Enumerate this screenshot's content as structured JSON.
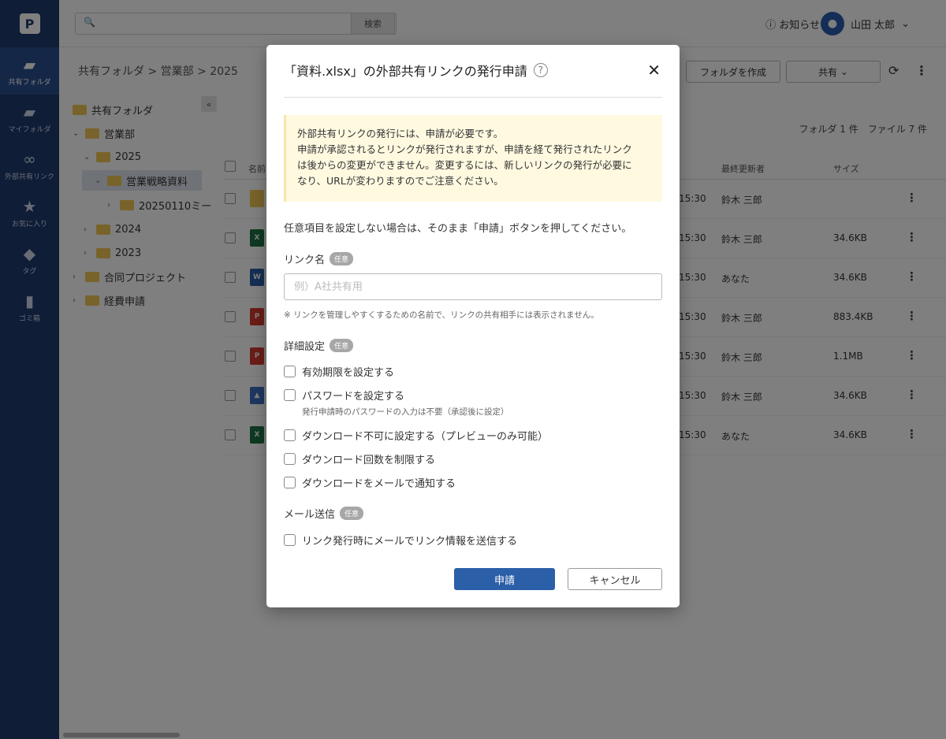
{
  "nav": {
    "logo_icon": "app-logo",
    "items": [
      {
        "label": "共有フォルダ",
        "icon": "shared-folder-icon"
      },
      {
        "label": "マイフォルダ",
        "icon": "folder-icon"
      },
      {
        "label": "外部共有リンク",
        "icon": "link-icon"
      },
      {
        "label": "お気に入り",
        "icon": "star-icon"
      },
      {
        "label": "タグ",
        "icon": "tag-icon"
      },
      {
        "label": "ゴミ箱",
        "icon": "trash-icon"
      }
    ]
  },
  "topbar": {
    "search_button": "検索",
    "notice_label": "お知らせ",
    "user_name": "山田 太郎"
  },
  "toolbar": {
    "breadcrumb": [
      "共有フォルダ",
      "営業部",
      "2025"
    ],
    "create_folder": "フォルダを作成",
    "share_select": "共有"
  },
  "tree": [
    {
      "label": "共有フォルダ"
    },
    {
      "label": "営業部"
    },
    {
      "label": "2025"
    },
    {
      "label": "営業戦略資料"
    },
    {
      "label": "20250110ミー"
    },
    {
      "label": "2024"
    },
    {
      "label": "2023"
    },
    {
      "label": "合同プロジェクト"
    },
    {
      "label": "経費申請"
    }
  ],
  "list": {
    "count": "フォルダ 1 件　ファイル 7 件",
    "columns": {
      "name": "名前",
      "updated_by": "最終更新者",
      "size": "サイズ"
    },
    "rows": [
      {
        "type": "folder",
        "time": "15:30",
        "owner": "鈴木 三郎",
        "size": ""
      },
      {
        "type": "excel",
        "time": "15:30",
        "owner": "鈴木 三郎",
        "size": "34.6KB"
      },
      {
        "type": "word",
        "time": "15:30",
        "owner": "あなた",
        "size": "34.6KB"
      },
      {
        "type": "pdf",
        "time": "15:30",
        "owner": "鈴木 三郎",
        "size": "883.4KB"
      },
      {
        "type": "pdf",
        "time": "15:30",
        "owner": "鈴木 三郎",
        "size": "1.1MB"
      },
      {
        "type": "image",
        "time": "15:30",
        "owner": "鈴木 三郎",
        "size": "34.6KB"
      },
      {
        "type": "excel",
        "time": "15:30",
        "owner": "あなた",
        "size": "34.6KB"
      }
    ]
  },
  "modal": {
    "title": "「資料.xlsx」の外部共有リンクの発行申請",
    "notice_lines": [
      "外部共有リンクの発行には、申請が必要です。",
      "申請が承認されるとリンクが発行されますが、申請を経て発行されたリンク",
      "は後からの変更ができません。変更するには、新しいリンクの発行が必要に",
      "なり、URLが変わりますのでご注意ください。"
    ],
    "instruction": "任意項目を設定しない場合は、そのまま「申請」ボタンを押してください。",
    "optional_badge": "任意",
    "link_name_label": "リンク名",
    "link_name_placeholder": "例）A社共有用",
    "link_name_value": "",
    "link_name_hint": "※ リンクを管理しやすくするための名前で、リンクの共有相手には表示されません。",
    "detail_label": "詳細設定",
    "options": [
      {
        "label": "有効期限を設定する",
        "checked": false
      },
      {
        "label": "パスワードを設定する",
        "checked": false
      },
      {
        "label": "ダウンロード不可に設定する（プレビューのみ可能）",
        "checked": false
      },
      {
        "label": "ダウンロード回数を制限する",
        "checked": false
      },
      {
        "label": "ダウンロードをメールで通知する",
        "checked": false
      }
    ],
    "password_hint": "発行申請時のパスワードの入力は不要（承認後に設定）",
    "mail_label": "メール送信",
    "mail_option": {
      "label": "リンク発行時にメールでリンク情報を送信する",
      "checked": false
    },
    "submit": "申請",
    "cancel": "キャンセル"
  }
}
